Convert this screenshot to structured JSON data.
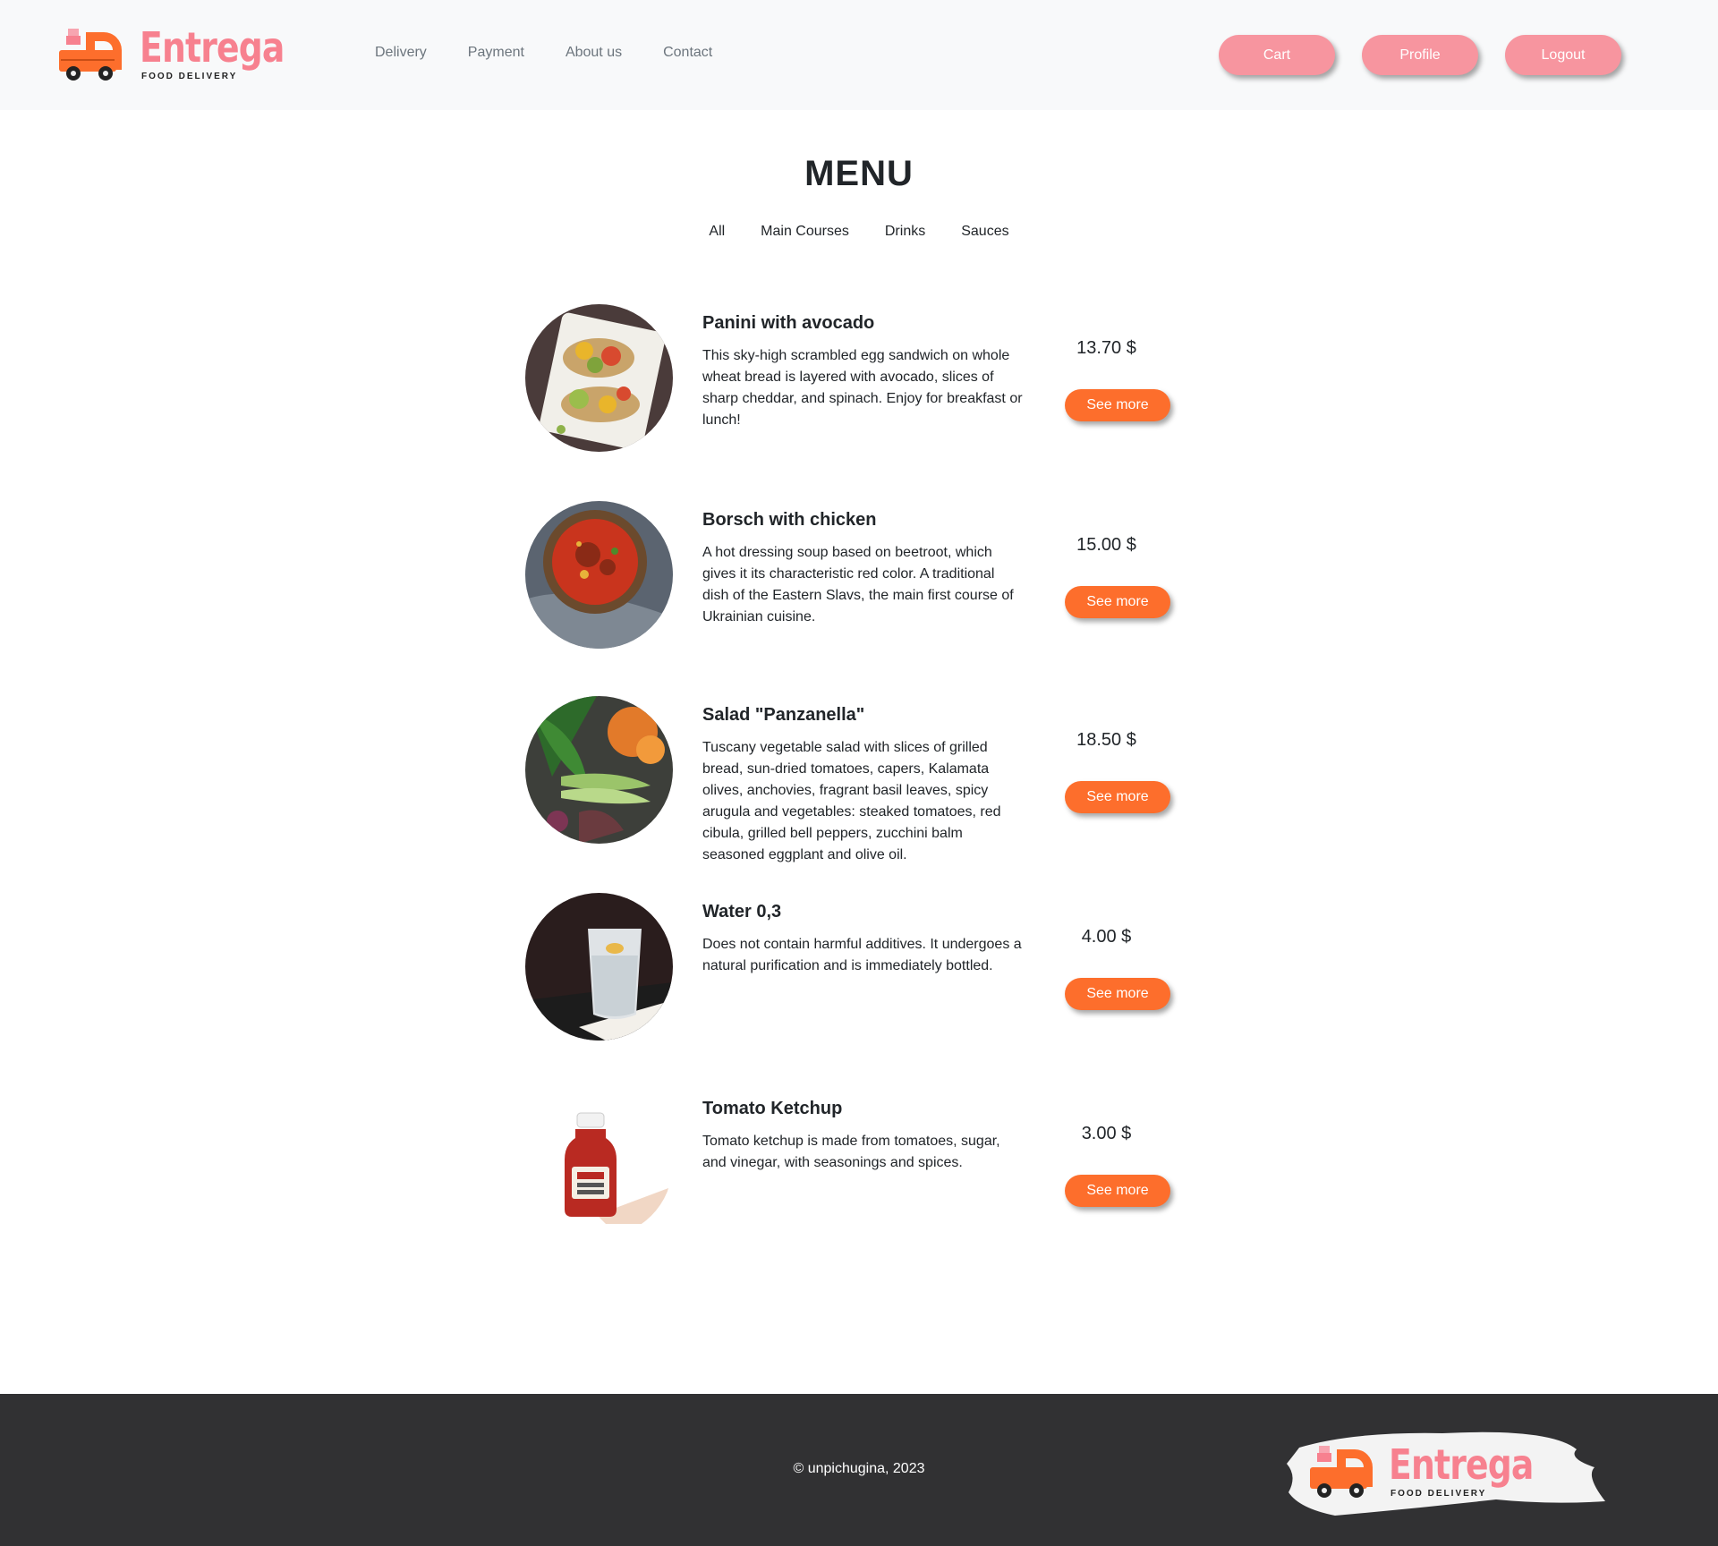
{
  "header": {
    "logo": {
      "word": "Entrega",
      "sub": "FOOD DELIVERY"
    },
    "nav": [
      "Delivery",
      "Payment",
      "About us",
      "Contact"
    ],
    "buttons": {
      "cart": "Cart",
      "profile": "Profile",
      "logout": "Logout"
    }
  },
  "menu": {
    "title": "MENU",
    "filters": [
      "All",
      "Main Courses",
      "Drinks",
      "Sauces"
    ],
    "items": [
      {
        "name": "Panini with avocado",
        "description": "This sky-high scrambled egg sandwich on whole wheat bread is layered with avocado, slices of sharp cheddar, and spinach. Enjoy for breakfast or lunch!",
        "price": "13.70 $",
        "button": "See more",
        "image": "panini-photo"
      },
      {
        "name": "Borsch with chicken",
        "description": "A hot dressing soup based on beetroot, which gives it its characteristic red color. A traditional dish of the Eastern Slavs, the main first course of Ukrainian cuisine.",
        "price": "15.00 $",
        "button": "See more",
        "image": "borsch-photo"
      },
      {
        "name": "Salad \"Panzanella\"",
        "description": "Tuscany vegetable salad with slices of grilled bread, sun-dried tomatoes, capers, Kalamata olives, anchovies, fragrant basil leaves, spicy arugula and vegetables: steaked tomatoes, red cibula, grilled bell peppers, zucchini balm seasoned eggplant and olive oil.",
        "price": "18.50 $",
        "button": "See more",
        "image": "salad-photo"
      },
      {
        "name": "Water 0,3",
        "description": "Does not contain harmful additives. It undergoes a natural purification and is immediately bottled.",
        "price": "4.00 $",
        "button": "See more",
        "image": "water-glass-photo"
      },
      {
        "name": "Tomato Ketchup",
        "description": "Tomato ketchup is made from tomatoes, sugar, and vinegar, with seasonings and spices.",
        "price": "3.00 $",
        "button": "See more",
        "image": "ketchup-bottle-photo"
      }
    ]
  },
  "footer": {
    "copyright": "© unpichugina, 2023"
  },
  "colors": {
    "brand_pink": "#f7959f",
    "brand_orange": "#fd6e2c",
    "footer_bg": "#313133",
    "header_bg": "#f8f9fa"
  }
}
